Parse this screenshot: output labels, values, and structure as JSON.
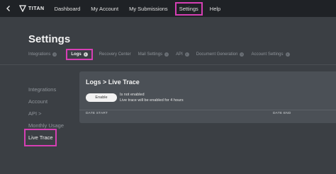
{
  "header": {
    "brand": "TITAN",
    "nav": [
      {
        "label": "Dashboard"
      },
      {
        "label": "My Account"
      },
      {
        "label": "My Submissions"
      },
      {
        "label": "Settings"
      },
      {
        "label": "Help"
      }
    ]
  },
  "page": {
    "title": "Settings"
  },
  "tabs": [
    {
      "label": "Integrations",
      "badge": "i"
    },
    {
      "label": "Logs",
      "badge": "i"
    },
    {
      "label": "Recovery Center",
      "badge": ""
    },
    {
      "label": "Mail Settings",
      "badge": "i"
    },
    {
      "label": "API",
      "badge": "i"
    },
    {
      "label": "Document Generation",
      "badge": "i"
    },
    {
      "label": "Account Settings",
      "badge": "i"
    }
  ],
  "sidebar": {
    "items": [
      {
        "label": "Integrations"
      },
      {
        "label": "Account"
      },
      {
        "label": "API >"
      },
      {
        "label": "Monthly Usage"
      },
      {
        "label": "Live Trace"
      }
    ]
  },
  "panel": {
    "title": "Logs > Live Trace",
    "enable_label": "Enable",
    "status_line1": "Is not enabled",
    "status_line2": "Live trace will be enabled for 4 hours",
    "col_start": "DATE START",
    "col_end": "DATE END"
  },
  "colors": {
    "highlight": "#d63fb4",
    "background": "#3b3f44",
    "topbar": "#1f2226"
  }
}
